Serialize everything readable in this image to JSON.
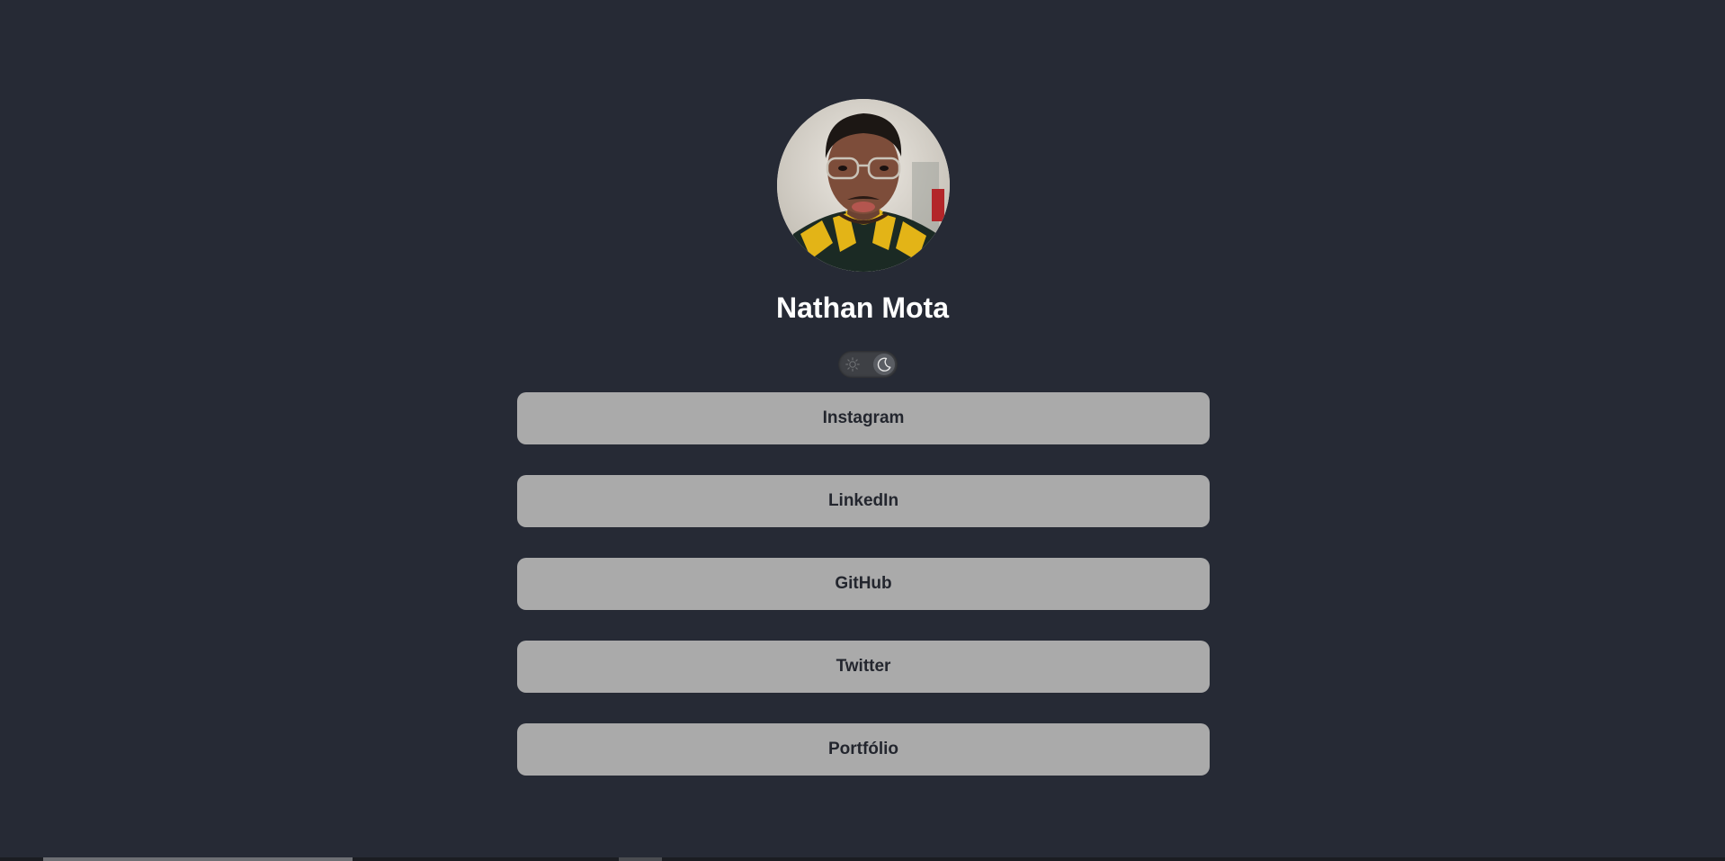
{
  "profile": {
    "name": "Nathan Mota",
    "avatar_alt": "profile-photo"
  },
  "theme_toggle": {
    "light_icon": "sun-icon",
    "dark_icon": "moon-icon",
    "state": "dark"
  },
  "links": [
    {
      "label": "Instagram"
    },
    {
      "label": "LinkedIn"
    },
    {
      "label": "GitHub"
    },
    {
      "label": "Twitter"
    },
    {
      "label": "Portfólio"
    }
  ],
  "colors": {
    "background": "#262a35",
    "button": "#aaaaaa",
    "button_text": "#23262e",
    "name_text": "#ffffff"
  }
}
